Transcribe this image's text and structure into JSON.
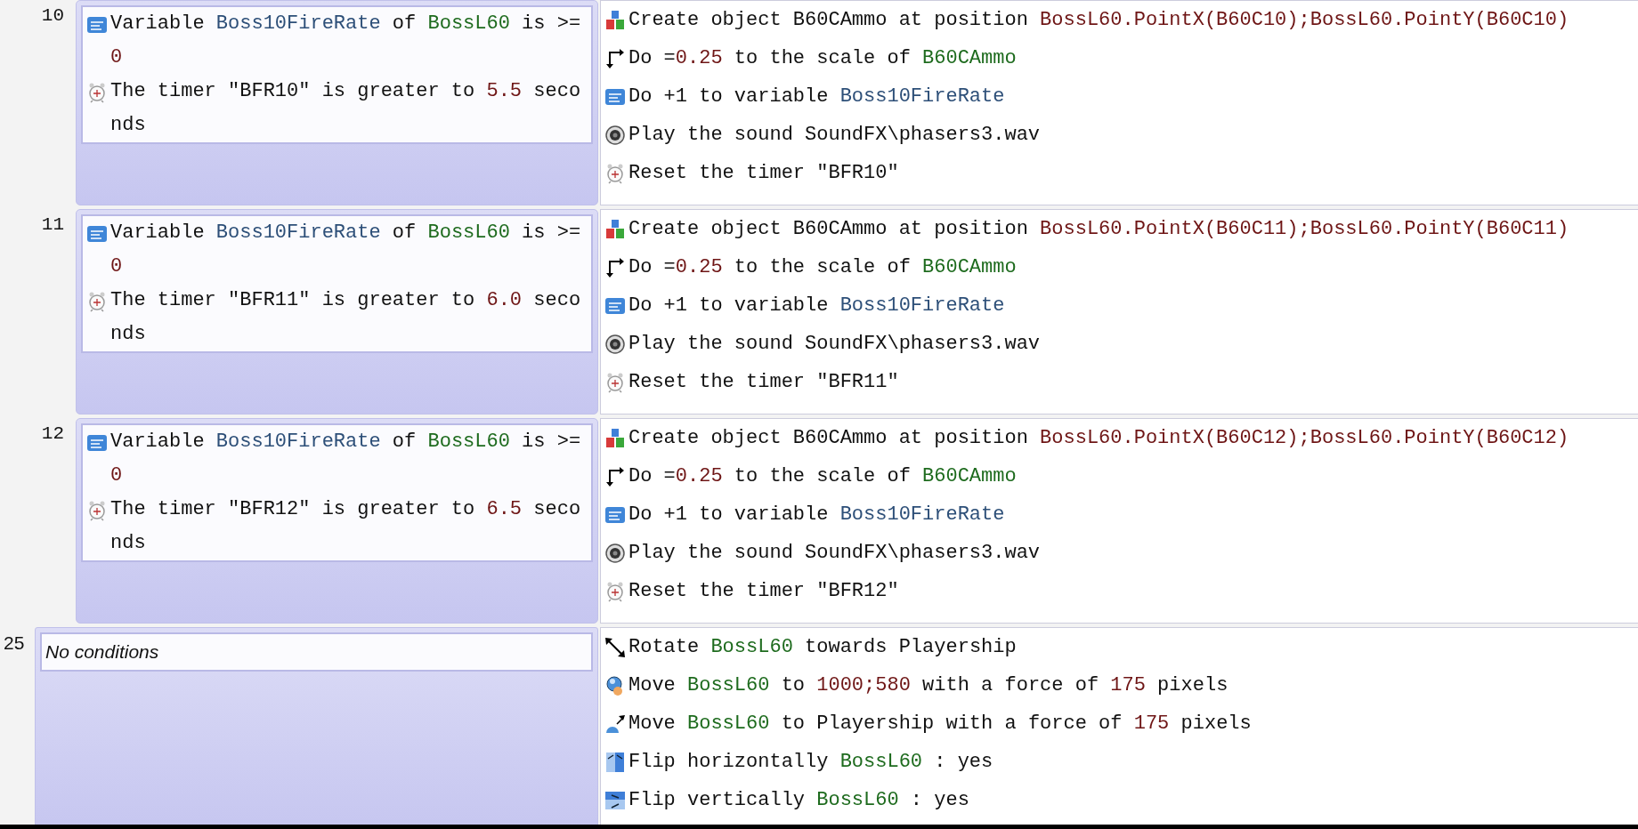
{
  "events": [
    {
      "number": "10",
      "kind": "subevent",
      "conditions": [
        {
          "kind": "variable",
          "parts": [
            {
              "text": "Variable ",
              "kind": "plain"
            },
            {
              "text": "Boss10FireRate",
              "kind": "variable"
            },
            {
              "text": " of ",
              "kind": "plain"
            },
            {
              "text": "BossL60",
              "kind": "object"
            },
            {
              "text": " is >= ",
              "kind": "plain"
            },
            {
              "text": "0",
              "kind": "value"
            }
          ]
        },
        {
          "kind": "timer",
          "parts": [
            {
              "text": "The timer \"BFR10\" is greater to ",
              "kind": "plain"
            },
            {
              "text": "5.5",
              "kind": "value"
            },
            {
              "text": " seconds",
              "kind": "plain"
            }
          ]
        }
      ],
      "actions": [
        {
          "kind": "object",
          "parts": [
            {
              "text": "Create object B60CAmmo at position ",
              "kind": "plain"
            },
            {
              "text": "BossL60.PointX(B60C10);BossL60.PointY(B60C10)",
              "kind": "value"
            }
          ]
        },
        {
          "kind": "scale",
          "parts": [
            {
              "text": "Do =",
              "kind": "plain"
            },
            {
              "text": "0.25",
              "kind": "value"
            },
            {
              "text": " to the scale of ",
              "kind": "plain"
            },
            {
              "text": "B60CAmmo",
              "kind": "object"
            }
          ]
        },
        {
          "kind": "variable",
          "parts": [
            {
              "text": "Do +1 to variable ",
              "kind": "plain"
            },
            {
              "text": "Boss10FireRate",
              "kind": "variable"
            }
          ]
        },
        {
          "kind": "sound",
          "parts": [
            {
              "text": "Play the sound SoundFX\\phasers3.wav",
              "kind": "plain"
            }
          ]
        },
        {
          "kind": "timer",
          "parts": [
            {
              "text": "Reset the timer \"BFR10\"",
              "kind": "plain"
            }
          ]
        }
      ]
    },
    {
      "number": "11",
      "kind": "subevent",
      "conditions": [
        {
          "kind": "variable",
          "parts": [
            {
              "text": "Variable ",
              "kind": "plain"
            },
            {
              "text": "Boss10FireRate",
              "kind": "variable"
            },
            {
              "text": " of ",
              "kind": "plain"
            },
            {
              "text": "BossL60",
              "kind": "object"
            },
            {
              "text": " is >= ",
              "kind": "plain"
            },
            {
              "text": "0",
              "kind": "value"
            }
          ]
        },
        {
          "kind": "timer",
          "parts": [
            {
              "text": "The timer \"BFR11\" is greater to ",
              "kind": "plain"
            },
            {
              "text": "6.0",
              "kind": "value"
            },
            {
              "text": " seconds",
              "kind": "plain"
            }
          ]
        }
      ],
      "actions": [
        {
          "kind": "object",
          "parts": [
            {
              "text": "Create object B60CAmmo at position ",
              "kind": "plain"
            },
            {
              "text": "BossL60.PointX(B60C11);BossL60.PointY(B60C11)",
              "kind": "value"
            }
          ]
        },
        {
          "kind": "scale",
          "parts": [
            {
              "text": "Do =",
              "kind": "plain"
            },
            {
              "text": "0.25",
              "kind": "value"
            },
            {
              "text": " to the scale of ",
              "kind": "plain"
            },
            {
              "text": "B60CAmmo",
              "kind": "object"
            }
          ]
        },
        {
          "kind": "variable",
          "parts": [
            {
              "text": "Do +1 to variable ",
              "kind": "plain"
            },
            {
              "text": "Boss10FireRate",
              "kind": "variable"
            }
          ]
        },
        {
          "kind": "sound",
          "parts": [
            {
              "text": "Play the sound SoundFX\\phasers3.wav",
              "kind": "plain"
            }
          ]
        },
        {
          "kind": "timer",
          "parts": [
            {
              "text": "Reset the timer \"BFR11\"",
              "kind": "plain"
            }
          ]
        }
      ]
    },
    {
      "number": "12",
      "kind": "subevent",
      "conditions": [
        {
          "kind": "variable",
          "parts": [
            {
              "text": "Variable ",
              "kind": "plain"
            },
            {
              "text": "Boss10FireRate",
              "kind": "variable"
            },
            {
              "text": " of ",
              "kind": "plain"
            },
            {
              "text": "BossL60",
              "kind": "object"
            },
            {
              "text": " is >= ",
              "kind": "plain"
            },
            {
              "text": "0",
              "kind": "value"
            }
          ]
        },
        {
          "kind": "timer",
          "parts": [
            {
              "text": "The timer \"BFR12\" is greater to ",
              "kind": "plain"
            },
            {
              "text": "6.5",
              "kind": "value"
            },
            {
              "text": " seconds",
              "kind": "plain"
            }
          ]
        }
      ],
      "actions": [
        {
          "kind": "object",
          "parts": [
            {
              "text": "Create object B60CAmmo at position ",
              "kind": "plain"
            },
            {
              "text": "BossL60.PointX(B60C12);BossL60.PointY(B60C12)",
              "kind": "value"
            }
          ]
        },
        {
          "kind": "scale",
          "parts": [
            {
              "text": "Do =",
              "kind": "plain"
            },
            {
              "text": "0.25",
              "kind": "value"
            },
            {
              "text": " to the scale of ",
              "kind": "plain"
            },
            {
              "text": "B60CAmmo",
              "kind": "object"
            }
          ]
        },
        {
          "kind": "variable",
          "parts": [
            {
              "text": "Do +1 to variable ",
              "kind": "plain"
            },
            {
              "text": "Boss10FireRate",
              "kind": "variable"
            }
          ]
        },
        {
          "kind": "sound",
          "parts": [
            {
              "text": "Play the sound SoundFX\\phasers3.wav",
              "kind": "plain"
            }
          ]
        },
        {
          "kind": "timer",
          "parts": [
            {
              "text": "Reset the timer \"BFR12\"",
              "kind": "plain"
            }
          ]
        }
      ]
    },
    {
      "number": "25",
      "kind": "event",
      "no_conditions_label": "No conditions",
      "actions": [
        {
          "kind": "rotate",
          "parts": [
            {
              "text": "Rotate ",
              "kind": "plain"
            },
            {
              "text": "BossL60",
              "kind": "object"
            },
            {
              "text": " towards Playership",
              "kind": "plain"
            }
          ]
        },
        {
          "kind": "move_position",
          "parts": [
            {
              "text": "Move ",
              "kind": "plain"
            },
            {
              "text": "BossL60",
              "kind": "object"
            },
            {
              "text": " to ",
              "kind": "plain"
            },
            {
              "text": "1000;580",
              "kind": "value"
            },
            {
              "text": " with a force of ",
              "kind": "plain"
            },
            {
              "text": "175",
              "kind": "value"
            },
            {
              "text": " pixels",
              "kind": "plain"
            }
          ]
        },
        {
          "kind": "move_object",
          "parts": [
            {
              "text": "Move ",
              "kind": "plain"
            },
            {
              "text": "BossL60",
              "kind": "object"
            },
            {
              "text": " to Playership with a force of ",
              "kind": "plain"
            },
            {
              "text": "175",
              "kind": "value"
            },
            {
              "text": " pixels",
              "kind": "plain"
            }
          ]
        },
        {
          "kind": "flip_h",
          "parts": [
            {
              "text": "Flip horizontally ",
              "kind": "plain"
            },
            {
              "text": "BossL60",
              "kind": "object"
            },
            {
              "text": " : yes",
              "kind": "plain"
            }
          ]
        },
        {
          "kind": "flip_v",
          "parts": [
            {
              "text": "Flip vertically ",
              "kind": "plain"
            },
            {
              "text": "BossL60",
              "kind": "object"
            },
            {
              "text": " : yes",
              "kind": "plain"
            }
          ]
        }
      ]
    }
  ]
}
